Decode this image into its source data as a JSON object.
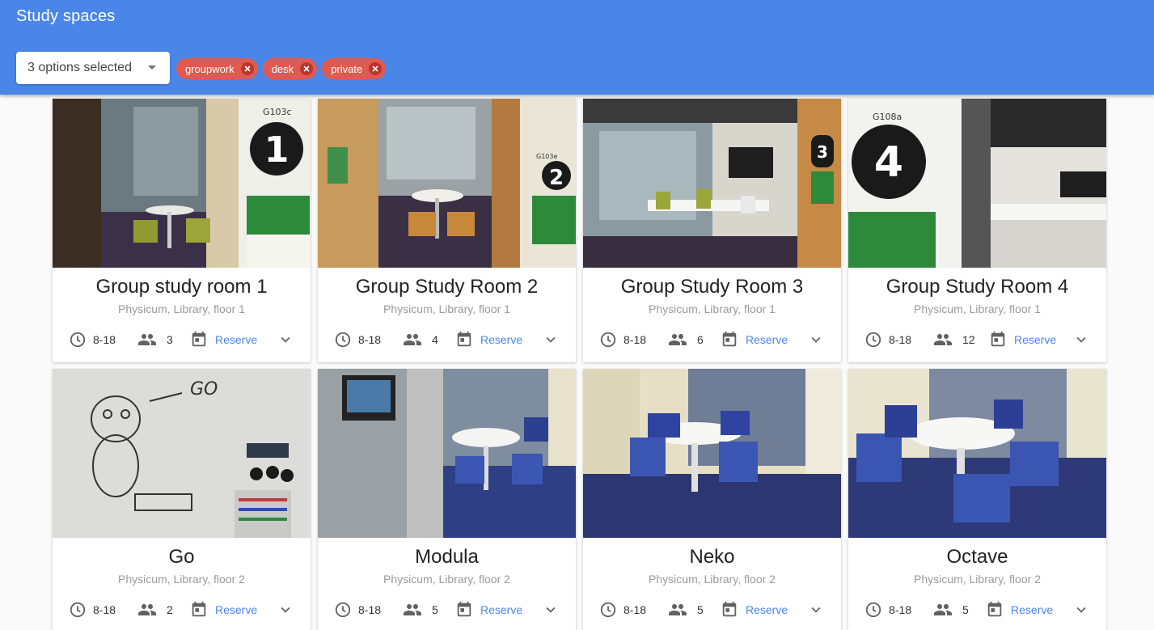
{
  "app": {
    "title": "Study spaces"
  },
  "filter": {
    "summary": "3 options selected",
    "chips": [
      {
        "label": "groupwork"
      },
      {
        "label": "desk"
      },
      {
        "label": "private"
      }
    ]
  },
  "colors": {
    "appbar": "#4a86e8",
    "chip": "#e05a52",
    "link": "#4a86e8"
  },
  "spaces": [
    {
      "name": "Group study room 1",
      "location": "Physicum, Library, floor 1",
      "hours": "8-18",
      "capacity": "3",
      "reserve": "Reserve",
      "sign": "1",
      "room_code": "G103c",
      "icons": [
        "clock-icon",
        "people-icon",
        "calendar-icon",
        "chevron-down-icon"
      ]
    },
    {
      "name": "Group Study Room 2",
      "location": "Physicum, Library, floor 1",
      "hours": "8-18",
      "capacity": "4",
      "reserve": "Reserve",
      "sign": "2",
      "room_code": "G103e"
    },
    {
      "name": "Group Study Room 3",
      "location": "Physicum, Library, floor 1",
      "hours": "8-18",
      "capacity": "6",
      "reserve": "Reserve",
      "sign": "3"
    },
    {
      "name": "Group Study Room 4",
      "location": "Physicum, Library, floor 1",
      "hours": "8-18",
      "capacity": "12",
      "reserve": "Reserve",
      "sign": "4",
      "room_code": "G108a"
    },
    {
      "name": "Go",
      "location": "Physicum, Library, floor 2",
      "hours": "8-18",
      "capacity": "2",
      "reserve": "Reserve",
      "whiteboard_text": "GO"
    },
    {
      "name": "Modula",
      "location": "Physicum, Library, floor 2",
      "hours": "8-18",
      "capacity": "5",
      "reserve": "Reserve"
    },
    {
      "name": "Neko",
      "location": "Physicum, Library, floor 2",
      "hours": "8-18",
      "capacity": "5",
      "reserve": "Reserve"
    },
    {
      "name": "Octave",
      "location": "Physicum, Library, floor 2",
      "hours": "8-18",
      "capacity": "5",
      "reserve": "Reserve"
    }
  ]
}
